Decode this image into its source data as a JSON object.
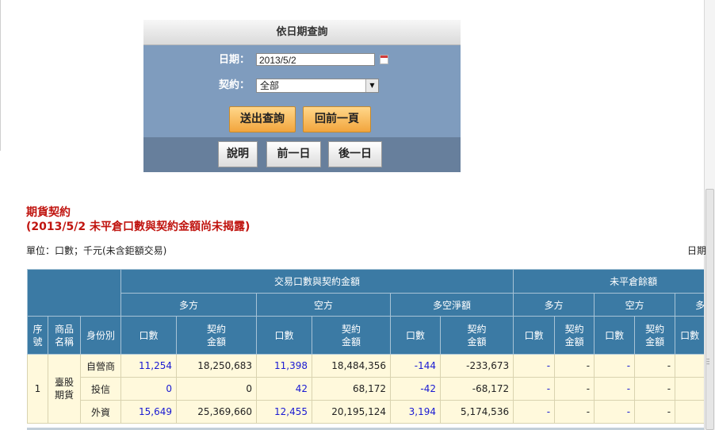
{
  "query": {
    "title": "依日期查詢",
    "date_label": "日期：",
    "date_value": "2013/5/2",
    "contract_label": "契約：",
    "contract_value": "全部",
    "submit_label": "送出查詢",
    "back_label": "回前一頁",
    "explain_label": "說明",
    "prev_day_label": "前一日",
    "next_day_label": "後一日"
  },
  "section": {
    "title_line1": "期貨契約",
    "title_line2": "(2013/5/2 未平倉口數與契約金額尚未揭露)",
    "unit_text": "單位：口數；千元(未含鉅額交易)",
    "date_text": "日期"
  },
  "table": {
    "group_trading": "交易口數與契約金額",
    "group_oi": "未平倉餘額",
    "sub_long": "多方",
    "sub_short": "空方",
    "sub_net": "多空淨額",
    "oi_long": "多方",
    "oi_short": "空方",
    "oi_third": "多",
    "col_seq": "序號",
    "col_product": "商品名稱",
    "col_identity": "身份別",
    "col_lots": "口數",
    "col_amount": "契約金額",
    "seq": "1",
    "product": "臺股期貨",
    "rows": [
      {
        "identity": "自營商",
        "long_lots": "11,254",
        "long_amt": "18,250,683",
        "short_lots": "11,398",
        "short_amt": "18,484,356",
        "net_lots": "-144",
        "net_amt": "-233,673",
        "oil_lots": "-",
        "oil_amt": "-",
        "ois_lots": "-",
        "ois_amt": "-"
      },
      {
        "identity": "投信",
        "long_lots": "0",
        "long_amt": "0",
        "short_lots": "42",
        "short_amt": "68,172",
        "net_lots": "-42",
        "net_amt": "-68,172",
        "oil_lots": "-",
        "oil_amt": "-",
        "ois_lots": "-",
        "ois_amt": "-"
      },
      {
        "identity": "外資",
        "long_lots": "15,649",
        "long_amt": "25,369,660",
        "short_lots": "12,455",
        "short_amt": "20,195,124",
        "net_lots": "3,194",
        "net_amt": "5,174,536",
        "oil_lots": "-",
        "oil_amt": "-",
        "ois_lots": "-",
        "ois_amt": "-"
      }
    ]
  }
}
